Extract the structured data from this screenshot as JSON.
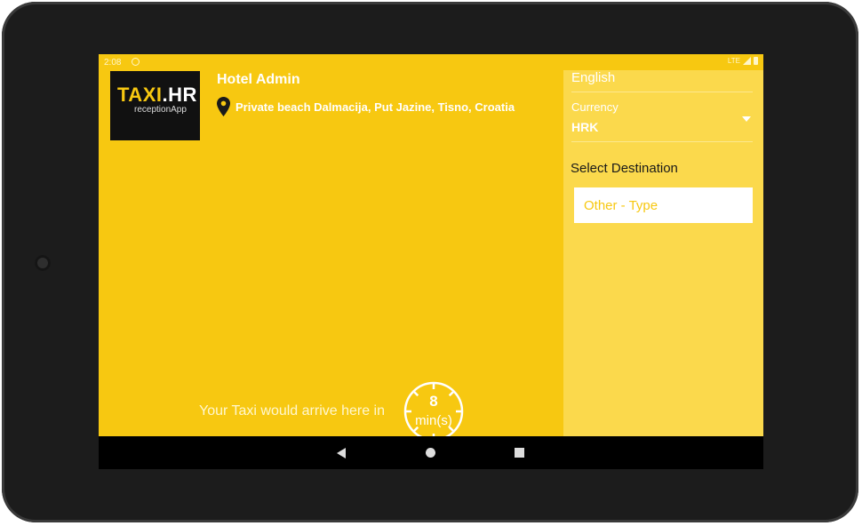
{
  "status_bar": {
    "time": "2:08",
    "network": "LTE",
    "notification_icon": "circle-notification-icon",
    "signal_icon": "signal-icon",
    "battery_icon": "battery-icon"
  },
  "logo": {
    "brand_main": "TAXI",
    "brand_suffix": ".HR",
    "subtitle": "receptionApp"
  },
  "header": {
    "hotel_name": "Hotel Admin",
    "location_icon": "location-pin-icon",
    "location": "Private beach Dalmacija, Put Jazine, Tisno, Croatia"
  },
  "arrival": {
    "text": "Your Taxi would arrive here in",
    "minutes": "8",
    "unit": "min(s)",
    "icon": "clock-icon"
  },
  "settings": {
    "language_value": "English",
    "currency_label": "Currency",
    "currency_value": "HRK",
    "currency_dropdown_icon": "dropdown-caret-icon",
    "destination_label": "Select Destination",
    "destination_placeholder": "Other - Type"
  },
  "nav_bar": {
    "back_icon": "back-icon",
    "home_icon": "home-icon",
    "recents_icon": "recents-icon"
  },
  "colors": {
    "primary": "#f7c811",
    "panel": "#fbd94c",
    "text_light": "#ffffff"
  }
}
